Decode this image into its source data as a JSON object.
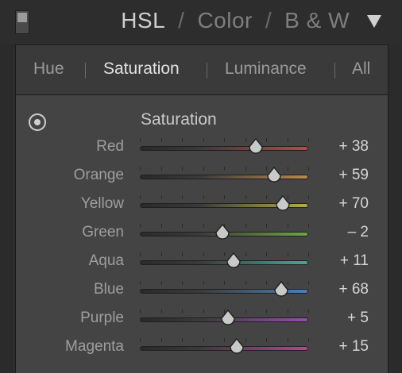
{
  "header": {
    "tabs": [
      "HSL",
      "Color",
      "B & W"
    ],
    "separator": "/",
    "active_tab_index": 0
  },
  "subtabs": {
    "items": [
      "Hue",
      "Saturation",
      "Luminance",
      "All"
    ],
    "active_index": 1
  },
  "section_title": "Saturation",
  "sliders": [
    {
      "label": "Red",
      "value": "+ 38",
      "numeric": 38,
      "color": "#b84a4a"
    },
    {
      "label": "Orange",
      "value": "+ 59",
      "numeric": 59,
      "color": "#b98a4c"
    },
    {
      "label": "Yellow",
      "value": "+ 70",
      "numeric": 70,
      "color": "#b3ad47"
    },
    {
      "label": "Green",
      "value": "– 2",
      "numeric": -2,
      "color": "#6fa446"
    },
    {
      "label": "Aqua",
      "value": "+ 11",
      "numeric": 11,
      "color": "#45a69c"
    },
    {
      "label": "Blue",
      "value": "+ 68",
      "numeric": 68,
      "color": "#4c7fb8"
    },
    {
      "label": "Purple",
      "value": "+ 5",
      "numeric": 5,
      "color": "#9b4ab3"
    },
    {
      "label": "Magenta",
      "value": "+ 15",
      "numeric": 15,
      "color": "#b2488f"
    }
  ],
  "slider_range": [
    -100,
    100
  ]
}
